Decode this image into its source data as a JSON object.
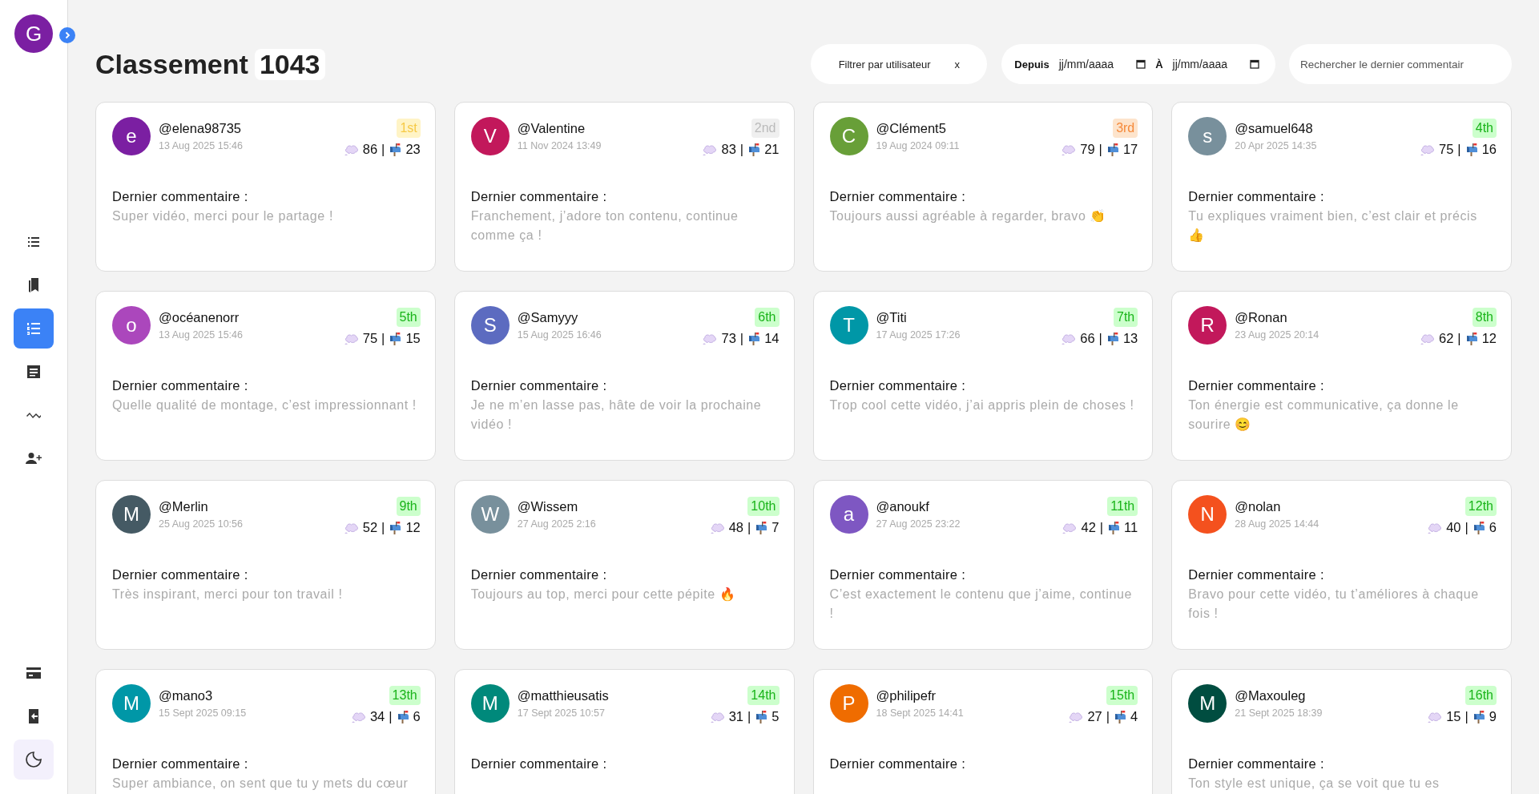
{
  "sidebar": {
    "avatar": {
      "letter": "G",
      "color": "#7b1fa2"
    },
    "nav": [
      {
        "kind": "list",
        "selected": false
      },
      {
        "kind": "bookmarks",
        "selected": false
      },
      {
        "kind": "ranking",
        "selected": true
      },
      {
        "kind": "article",
        "selected": false
      },
      {
        "kind": "trend",
        "selected": false
      },
      {
        "kind": "add-user",
        "selected": false
      }
    ],
    "bottom": [
      {
        "kind": "card"
      },
      {
        "kind": "logout"
      },
      {
        "kind": "theme"
      }
    ]
  },
  "header": {
    "title": "Classement",
    "count": "1043",
    "user_filter": {
      "label": "Filtrer par utilisateur",
      "clear": "x"
    },
    "date_range": {
      "from_label": "Depuis",
      "from_placeholder": "jj/mm/aaaa",
      "to_label": "À",
      "to_placeholder": "jj/mm/aaaa"
    },
    "search": {
      "placeholder": "Rechercher le dernier commentair"
    }
  },
  "cards": [
    {
      "letter": "e",
      "color": "#7b1fa2",
      "username": "@elena98735",
      "date": "13 Aug 2025 15:46",
      "rank": "1st",
      "kind": "gold",
      "comments": "86",
      "separator": "|",
      "messages": "23",
      "label": "Dernier commentaire :",
      "comment": "Super vidéo, merci pour le partage !"
    },
    {
      "letter": "V",
      "color": "#c2185b",
      "username": "@Valentine",
      "date": "11 Nov 2024 13:49",
      "rank": "2nd",
      "kind": "silver",
      "comments": "83",
      "separator": "|",
      "messages": "21",
      "label": "Dernier commentaire :",
      "comment": "Franchement, j’adore ton contenu, continue comme ça !"
    },
    {
      "letter": "C",
      "color": "#689f38",
      "username": "@Clément5",
      "date": "19 Aug 2024 09:11",
      "rank": "3rd",
      "kind": "bronze",
      "comments": "79",
      "separator": "|",
      "messages": "17",
      "label": "Dernier commentaire :",
      "comment": "Toujours aussi agréable à regarder, bravo 👏"
    },
    {
      "letter": "s",
      "color": "#78909c",
      "username": "@samuel648",
      "date": "20 Apr 2025 14:35",
      "rank": "4th",
      "kind": "other",
      "comments": "75",
      "separator": "|",
      "messages": "16",
      "label": "Dernier commentaire :",
      "comment": "Tu expliques vraiment bien, c’est clair et précis 👍"
    },
    {
      "letter": "o",
      "color": "#ab47bc",
      "username": "@océanenorr",
      "date": "13 Aug 2025 15:46",
      "rank": "5th",
      "kind": "other",
      "comments": "75",
      "separator": "|",
      "messages": "15",
      "label": "Dernier commentaire :",
      "comment": "Quelle qualité de montage, c’est impressionnant !"
    },
    {
      "letter": "S",
      "color": "#5c6bc0",
      "username": "@Samyyy",
      "date": "15 Aug 2025 16:46",
      "rank": "6th",
      "kind": "other",
      "comments": "73",
      "separator": "|",
      "messages": "14",
      "label": "Dernier commentaire :",
      "comment": "Je ne m’en lasse pas, hâte de voir la prochaine vidéo !"
    },
    {
      "letter": "T",
      "color": "#0097a7",
      "username": "@Titi",
      "date": "17 Aug 2025 17:26",
      "rank": "7th",
      "kind": "other",
      "comments": "66",
      "separator": "|",
      "messages": "13",
      "label": "Dernier commentaire :",
      "comment": "Trop cool cette vidéo, j’ai appris plein de choses !"
    },
    {
      "letter": "R",
      "color": "#c2185b",
      "username": "@Ronan",
      "date": "23 Aug 2025 20:14",
      "rank": "8th",
      "kind": "other",
      "comments": "62",
      "separator": "|",
      "messages": "12",
      "label": "Dernier commentaire :",
      "comment": "Ton énergie est communicative, ça donne le sourire 😊"
    },
    {
      "letter": "M",
      "color": "#455a64",
      "username": "@Merlin",
      "date": "25 Aug 2025 10:56",
      "rank": "9th",
      "kind": "other",
      "comments": "52",
      "separator": "|",
      "messages": "12",
      "label": "Dernier commentaire :",
      "comment": "Très inspirant, merci pour ton travail !"
    },
    {
      "letter": "W",
      "color": "#78909c",
      "username": "@Wissem",
      "date": "27 Aug 2025 2:16",
      "rank": "10th",
      "kind": "other",
      "comments": "48",
      "separator": "|",
      "messages": "7",
      "label": "Dernier commentaire :",
      "comment": "Toujours au top, merci pour cette pépite 🔥"
    },
    {
      "letter": "a",
      "color": "#7e57c2",
      "username": "@anoukf",
      "date": "27 Aug 2025 23:22",
      "rank": "11th",
      "kind": "other",
      "comments": "42",
      "separator": "|",
      "messages": "11",
      "label": "Dernier commentaire :",
      "comment": "C’est exactement le contenu que j’aime, continue !"
    },
    {
      "letter": "N",
      "color": "#f4511e",
      "username": "@nolan",
      "date": "28 Aug 2025 14:44",
      "rank": "12th",
      "kind": "other",
      "comments": "40",
      "separator": "|",
      "messages": "6",
      "label": "Dernier commentaire :",
      "comment": "Bravo pour cette vidéo, tu t’améliores à chaque fois !"
    },
    {
      "letter": "M",
      "color": "#0097a7",
      "username": "@mano3",
      "date": "15 Sept 2025 09:15",
      "rank": "13th",
      "kind": "other",
      "comments": "34",
      "separator": "|",
      "messages": "6",
      "label": "Dernier commentaire :",
      "comment": "Super ambiance, on sent que tu y mets du cœur"
    },
    {
      "letter": "M",
      "color": "#00897b",
      "username": "@matthieusatis",
      "date": "17 Sept 2025 10:57",
      "rank": "14th",
      "kind": "other",
      "comments": "31",
      "separator": "|",
      "messages": "5",
      "label": "Dernier commentaire :"
    },
    {
      "letter": "P",
      "color": "#ef6c00",
      "username": "@philipefr",
      "date": "18 Sept 2025 14:41",
      "rank": "15th",
      "kind": "other",
      "comments": "27",
      "separator": "|",
      "messages": "4",
      "label": "Dernier commentaire :"
    },
    {
      "letter": "M",
      "color": "#004d40",
      "username": "@Maxouleg",
      "date": "21 Sept 2025 18:39",
      "rank": "16th",
      "kind": "other",
      "comments": "15",
      "separator": "|",
      "messages": "9",
      "label": "Dernier commentaire :",
      "comment": "Ton style est unique, ça se voit que tu es"
    }
  ]
}
